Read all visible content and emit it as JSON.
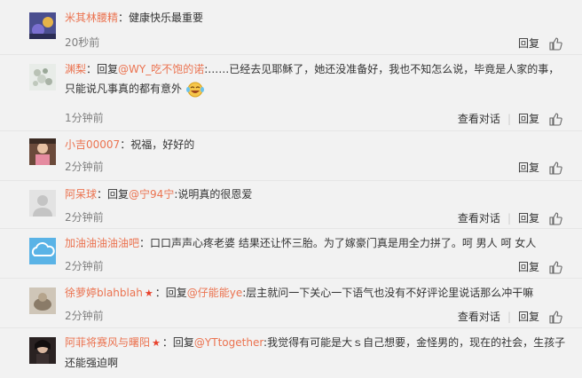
{
  "actions": {
    "reply": "回复",
    "view_conversation": "查看对话"
  },
  "comments": [
    {
      "user": "米其林腰精",
      "sep": "：",
      "text": "健康快乐最重要",
      "time": "20秒前"
    },
    {
      "user": "渊梨",
      "sep": "：",
      "reply_prefix": "回复",
      "mention": "@WY_吃不饱的诺",
      "line1": ":……已经去见耶稣了，她还没准备好，我也不知怎么说，毕竟是人家的事，",
      "line2": "只能说凡事真的都有意外",
      "time": "1分钟前"
    },
    {
      "user": "小吉00007",
      "sep": "：",
      "text": "祝福，好好的",
      "time": "2分钟前"
    },
    {
      "user": "阿呆球",
      "sep": "：",
      "reply_prefix": "回复",
      "mention": "@宁94宁",
      "text": ":说明真的很恩爱",
      "time": "2分钟前"
    },
    {
      "user": "加油油油油油吧",
      "sep": "：",
      "text": "口口声声心疼老婆 结果还让怀三胎。为了嫁豪门真是用全力拼了。呵 男人 呵 女人",
      "time": "2分钟前"
    },
    {
      "user": "徐萝婷blahblah",
      "sep": "：",
      "reply_prefix": "回复",
      "mention": "@仔能能ye",
      "text": ":层主就问一下关心一下语气也没有不好评论里说话那么冲干嘛",
      "time": "2分钟前"
    },
    {
      "user": "阿菲将赛风与曙阳",
      "sep": "：",
      "reply_prefix": "回复",
      "mention": "@YTtogether",
      "line1": ":我觉得有可能是大ｓ自己想要，金怪男的，现在的社会，生孩子",
      "line2": "还能强迫啊"
    }
  ]
}
